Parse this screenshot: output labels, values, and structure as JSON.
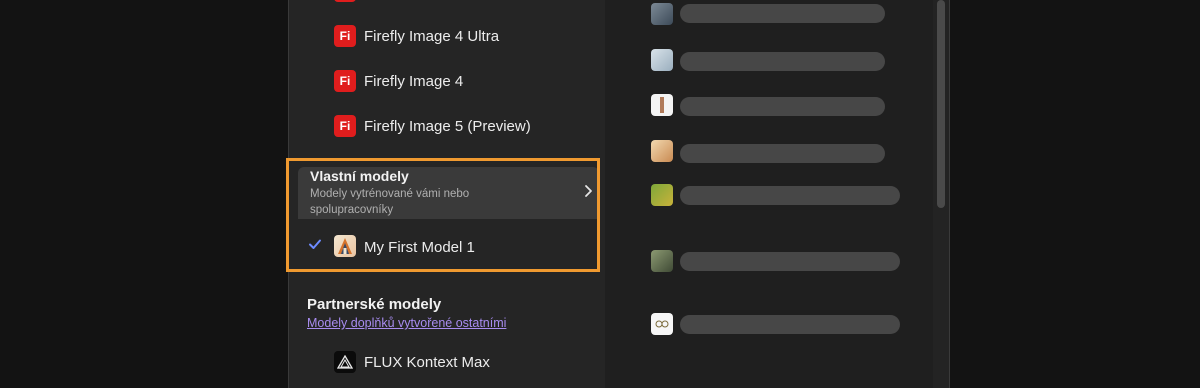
{
  "firefly_models": [
    {
      "badge": "Fi",
      "label": "Firefly Image 4 Ultra"
    },
    {
      "badge": "Fi",
      "label": "Firefly Image 4"
    },
    {
      "badge": "Fi",
      "label": "Firefly Image 5 (Preview)"
    }
  ],
  "custom_models": {
    "title": "Vlastní modely",
    "subtitle": "Modely vytrénované vámi nebo spolupracovníky",
    "chevron_icon": "chevron-right-icon",
    "selected_model": "My First Model 1",
    "check_icon": "checkmark-icon"
  },
  "partner_models": {
    "title": "Partnerské modely",
    "link": "Modely doplňků vytvořené ostatními",
    "items": [
      {
        "label": "FLUX Kontext Max",
        "icon": "flux-triangle-icon"
      }
    ]
  },
  "colors": {
    "firefly_red": "#e01d1d",
    "highlight_orange": "#f09a30",
    "link_purple": "#a88cf0",
    "check_blue": "#6d8bff"
  }
}
